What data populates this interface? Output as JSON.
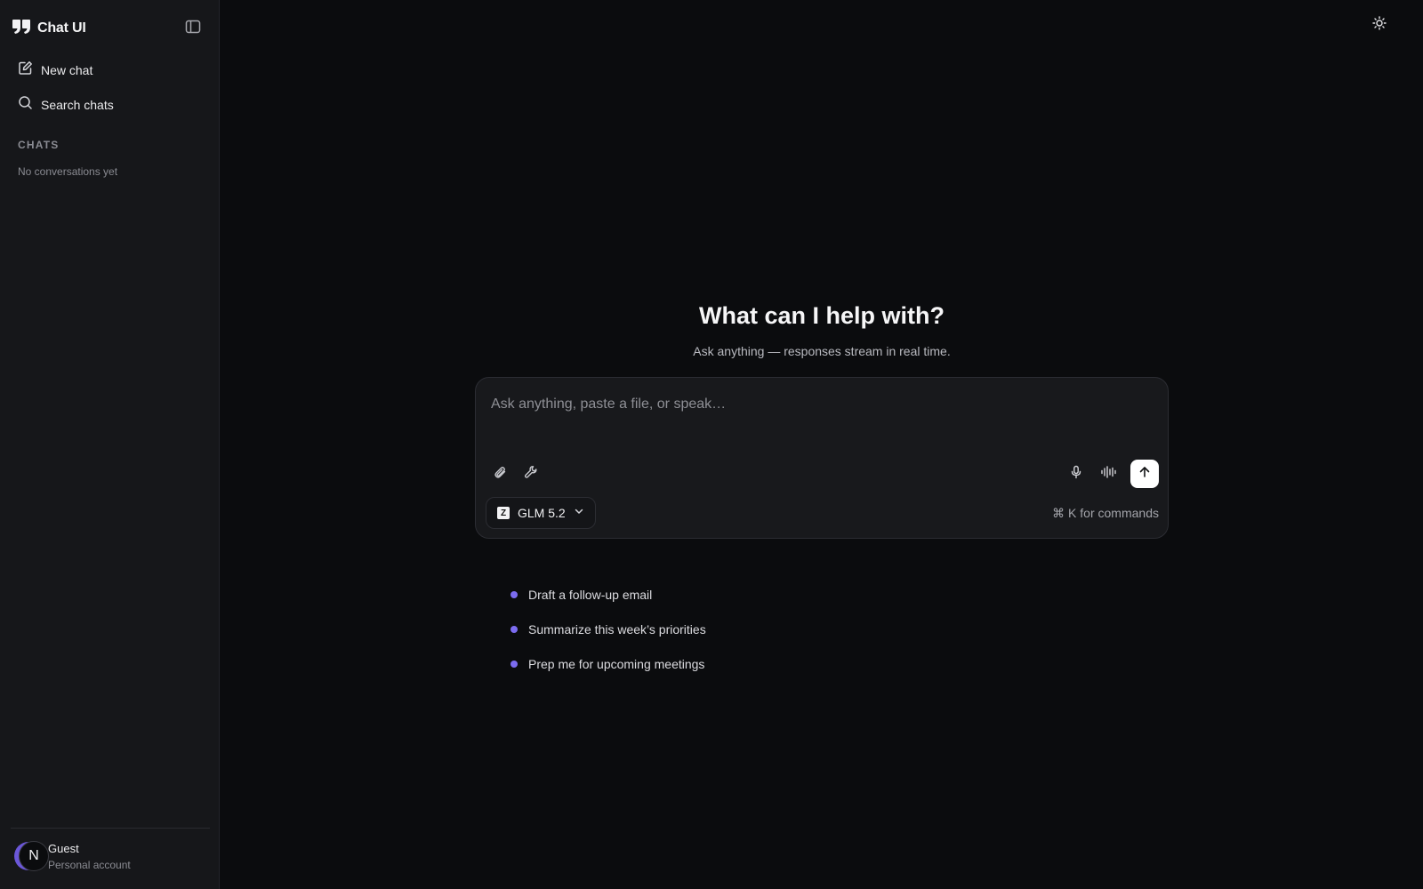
{
  "sidebar": {
    "brand": {
      "title": "Chat UI"
    },
    "nav": [
      {
        "label": "New chat",
        "icon": "pencil-square-icon"
      },
      {
        "label": "Search chats",
        "icon": "search-icon"
      }
    ],
    "section_title": "CHATS",
    "empty_note": "No conversations yet",
    "user": {
      "initial": "N",
      "name": "Guest",
      "subtitle": "Personal account"
    }
  },
  "main": {
    "title": "What can I help with?",
    "subtitle": "Ask anything — responses stream in real time.",
    "composer": {
      "placeholder": "Ask anything, paste a file, or speak…",
      "value": "",
      "model": {
        "logo": "Z",
        "name": "GLM 5.2"
      },
      "commands_hint": "⌘ K for commands"
    },
    "suggestions": [
      "Draft a follow-up email",
      "Summarize this week’s priorities",
      "Prep me for upcoming meetings"
    ]
  },
  "colors": {
    "background": "#0b0c0e",
    "sidebar": "#16171a",
    "accent": "#7c6cf0",
    "send_button": "#ffffff"
  }
}
